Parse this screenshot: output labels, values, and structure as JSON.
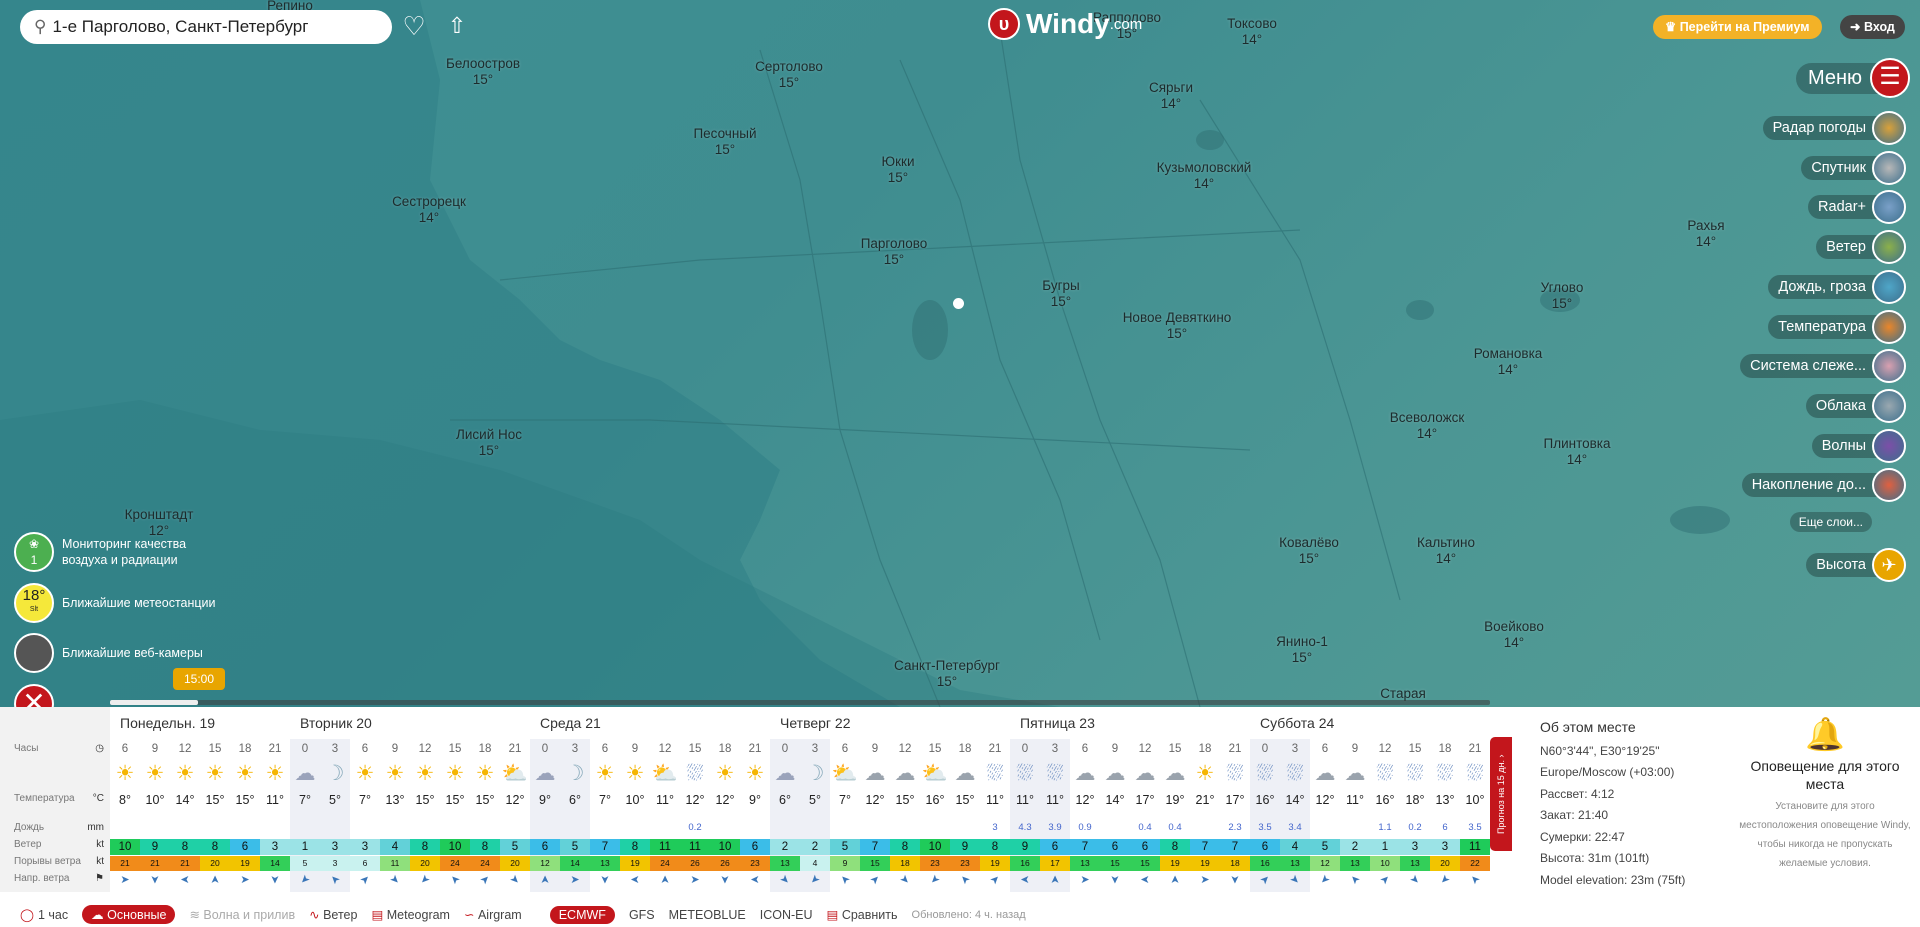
{
  "search": {
    "value": "1-е Парголово, Санкт-Петербург"
  },
  "logo": {
    "text": "Windy",
    "suffix": ".com"
  },
  "header": {
    "premium": "Перейти на Премиум",
    "login": "Вход",
    "menu": "Меню"
  },
  "layers": [
    "Радар погоды",
    "Спутник",
    "Radar+",
    "Ветер",
    "Дождь, гроза",
    "Температура",
    "Система слеже...",
    "Облака",
    "Волны",
    "Накопление до..."
  ],
  "more_layers": "Еще слои...",
  "altitude": "Высота",
  "left_panel": {
    "air_quality_count": "1",
    "air_quality": "Мониторинг качества воздуха и радиации",
    "stations_temp": "18°",
    "stations_sub": "Slt",
    "stations": "Ближайшие метеостанции",
    "webcams": "Ближайшие веб-камеры"
  },
  "time_bubble": "15:00",
  "places": [
    {
      "n": "Репино",
      "t": ""
    },
    {
      "n": "Белоостров",
      "t": "15°"
    },
    {
      "n": "Сертолово",
      "t": "15°"
    },
    {
      "n": "Рапполово",
      "t": "15°"
    },
    {
      "n": "Токсово",
      "t": "14°"
    },
    {
      "n": "Сярьги",
      "t": "14°"
    },
    {
      "n": "Песочный",
      "t": "15°"
    },
    {
      "n": "Юкки",
      "t": "15°"
    },
    {
      "n": "Кузьмоловский",
      "t": "14°"
    },
    {
      "n": "Сестрорецк",
      "t": "14°"
    },
    {
      "n": "Парголово",
      "t": "15°"
    },
    {
      "n": "Рахья",
      "t": "14°"
    },
    {
      "n": "Бугры",
      "t": "15°"
    },
    {
      "n": "Новое Девяткино",
      "t": "15°"
    },
    {
      "n": "Углово",
      "t": "15°"
    },
    {
      "n": "Романовка",
      "t": "14°"
    },
    {
      "n": "Всеволожск",
      "t": "14°"
    },
    {
      "n": "Лисий Нос",
      "t": "15°"
    },
    {
      "n": "Плинтовка",
      "t": "14°"
    },
    {
      "n": "Кронштадт",
      "t": "12°"
    },
    {
      "n": "Ковалёво",
      "t": "15°"
    },
    {
      "n": "Кальтино",
      "t": "14°"
    },
    {
      "n": "Янино-1",
      "t": "15°"
    },
    {
      "n": "Воейково",
      "t": "14°"
    },
    {
      "n": "Санкт-Петербург",
      "t": "15°"
    },
    {
      "n": "Старая",
      "t": ""
    }
  ],
  "row_labels": {
    "hours": "Часы",
    "temp": "Температура",
    "temp_unit": "°C",
    "rain": "Дождь",
    "rain_unit": "mm",
    "wind": "Ветер",
    "wind_unit": "kt",
    "gust": "Порывы ветра",
    "gust_unit": "kt",
    "dir": "Напр. ветра"
  },
  "days": [
    {
      "name": "Понедельн. 19",
      "hours": [
        "6",
        "9",
        "12",
        "15",
        "18",
        "21"
      ],
      "icons": [
        "sun",
        "sun",
        "sun",
        "sun",
        "sun",
        "sun"
      ],
      "temps": [
        "8°",
        "10°",
        "14°",
        "15°",
        "15°",
        "11°"
      ],
      "rain": [
        "",
        "",
        "",
        "",
        "",
        ""
      ],
      "wind": [
        "10",
        "9",
        "8",
        "8",
        "6",
        "3"
      ],
      "gust": [
        "21",
        "21",
        "21",
        "20",
        "19",
        "14"
      ]
    },
    {
      "name": "Вторник 20",
      "hours": [
        "0",
        "3",
        "6",
        "9",
        "12",
        "15",
        "18",
        "21"
      ],
      "icons": [
        "night-cloud",
        "moon",
        "sun",
        "sun",
        "sun",
        "sun",
        "sun",
        "sun-cloud"
      ],
      "temps": [
        "7°",
        "5°",
        "7°",
        "13°",
        "15°",
        "15°",
        "15°",
        "12°"
      ],
      "rain": [
        "",
        "",
        "",
        "",
        "",
        "",
        "",
        ""
      ],
      "wind": [
        "1",
        "3",
        "3",
        "4",
        "8",
        "10",
        "8",
        "5"
      ],
      "gust": [
        "5",
        "3",
        "6",
        "11",
        "20",
        "24",
        "24",
        "20"
      ]
    },
    {
      "name": "Среда 21",
      "hours": [
        "0",
        "3",
        "6",
        "9",
        "12",
        "15",
        "18",
        "21"
      ],
      "icons": [
        "night-cloud",
        "moon",
        "sun",
        "sun",
        "sun-cloud",
        "rain",
        "sun",
        "sun"
      ],
      "temps": [
        "9°",
        "6°",
        "7°",
        "10°",
        "11°",
        "12°",
        "12°",
        "9°"
      ],
      "rain": [
        "",
        "",
        "",
        "",
        "",
        "0.2",
        "",
        ""
      ],
      "wind": [
        "6",
        "5",
        "7",
        "8",
        "11",
        "11",
        "10",
        "6"
      ],
      "gust": [
        "12",
        "14",
        "13",
        "19",
        "24",
        "26",
        "26",
        "23"
      ]
    },
    {
      "name": "Четверг 22",
      "hours": [
        "0",
        "3",
        "6",
        "9",
        "12",
        "15",
        "18",
        "21"
      ],
      "icons": [
        "night-cloud",
        "moon",
        "sun-cloud",
        "cloud",
        "cloud",
        "sun-cloud",
        "cloud",
        "rain"
      ],
      "temps": [
        "6°",
        "5°",
        "7°",
        "12°",
        "15°",
        "16°",
        "15°",
        "11°"
      ],
      "rain": [
        "",
        "",
        "",
        "",
        "",
        "",
        "",
        "3"
      ],
      "wind": [
        "2",
        "2",
        "5",
        "7",
        "8",
        "10",
        "9",
        "8"
      ],
      "gust": [
        "13",
        "4",
        "9",
        "15",
        "18",
        "23",
        "23",
        "19"
      ]
    },
    {
      "name": "Пятница 23",
      "hours": [
        "0",
        "3",
        "6",
        "9",
        "12",
        "15",
        "18",
        "21"
      ],
      "icons": [
        "rain",
        "rain",
        "cloud",
        "cloud",
        "cloud",
        "cloud",
        "sun",
        "rain"
      ],
      "temps": [
        "11°",
        "11°",
        "12°",
        "14°",
        "17°",
        "19°",
        "21°",
        "17°"
      ],
      "rain": [
        "4.3",
        "3.9",
        "0.9",
        "",
        "0.4",
        "0.4",
        "",
        "2.3"
      ],
      "wind": [
        "9",
        "6",
        "7",
        "6",
        "6",
        "8",
        "7",
        "7"
      ],
      "gust": [
        "16",
        "17",
        "13",
        "15",
        "15",
        "19",
        "19",
        "18"
      ]
    },
    {
      "name": "Суббота 24",
      "hours": [
        "0",
        "3",
        "6",
        "9",
        "12",
        "15",
        "18",
        "21"
      ],
      "icons": [
        "rain",
        "rain",
        "cloud",
        "cloud",
        "rain",
        "rain",
        "rain",
        "rain"
      ],
      "temps": [
        "16°",
        "14°",
        "12°",
        "11°",
        "16°",
        "18°",
        "13°",
        "10°"
      ],
      "rain": [
        "3.5",
        "3.4",
        "",
        "",
        "1.1",
        "0.2",
        "6",
        "3.5"
      ],
      "wind": [
        "6",
        "4",
        "5",
        "2",
        "1",
        "3",
        "3",
        "11"
      ],
      "gust": [
        "16",
        "13",
        "12",
        "13",
        "10",
        "13",
        "20",
        "22"
      ]
    }
  ],
  "forecast_tab": "Прогноз на 15 дн. ›",
  "about": {
    "title": "Об этом месте",
    "coords": "N60°3'44\", E30°19'25\"",
    "tz": "Europe/Moscow (+03:00)",
    "sunrise": "Рассвет: 4:12",
    "sunset": "Закат: 21:40",
    "dusk": "Сумерки: 22:47",
    "alt": "Высота: 31m (101ft)",
    "model": "Model elevation: 23m (75ft)"
  },
  "alert": {
    "title": "Оповещение для этого места",
    "desc": "Установите для этого местоположения оповещение Windy, чтобы никогда не пропускать желаемые условия."
  },
  "bottom": {
    "step": "1 час",
    "basic": "Основные",
    "waves": "Волна и прилив",
    "wind": "Ветер",
    "meteogram": "Meteogram",
    "airgram": "Airgram",
    "ecmwf": "ECMWF",
    "gfs": "GFS",
    "meteoblue": "METEOBLUE",
    "iconeu": "ICON-EU",
    "compare": "Сравнить",
    "updated": "Обновлено: 4 ч. назад"
  },
  "colors": {
    "accent": "#c3161c",
    "premium": "#f3b227",
    "map": "#3f8d90"
  }
}
